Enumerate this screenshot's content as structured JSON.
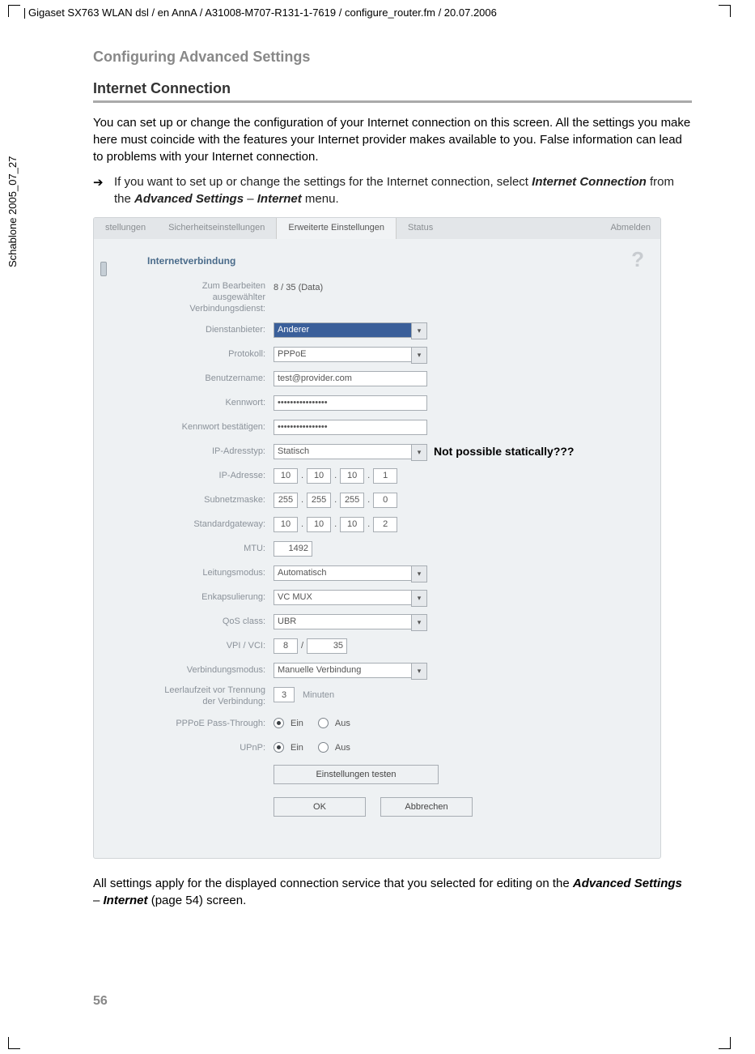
{
  "doc": {
    "header_path": "Gigaset SX763 WLAN dsl / en AnnA / A31008-M707-R131-1-7619 / configure_router.fm / 20.07.2006",
    "side_text": "Schablone 2005_07_27",
    "section_title": "Configuring Advanced Settings",
    "h2": "Internet Connection",
    "para1": "You can set up or change the configuration of your Internet connection on this screen. All the settings you make here must coincide with the features your Internet provider makes available to you. False information can lead to problems with your Internet connection.",
    "bullet_pre": "If you want to set up or change the settings for the Internet connection, select ",
    "bullet_bi1": "Internet Connection",
    "bullet_mid": " from the ",
    "bullet_bi2": "Advanced Settings",
    "bullet_sep": " – ",
    "bullet_bi3": "Internet",
    "bullet_post": " menu.",
    "foot_pre": "All settings apply for the displayed connection service that you selected for editing on the ",
    "foot_bi1": "Advanced Settings",
    "foot_sep": " – ",
    "foot_bi2": "Internet",
    "foot_post": " (page 54) screen.",
    "page_num": "56"
  },
  "ui": {
    "tabs": [
      "stellungen",
      "Sicherheitseinstellungen",
      "Erweiterte Einstellungen",
      "Status"
    ],
    "logout": "Abmelden",
    "panel_title": "Internetverbindung",
    "help": "?",
    "annotation": "Not possible statically???",
    "labels": {
      "service": "Zum Bearbeiten ausgewählter Verbindungsdienst:",
      "service_l1": "Zum Bearbeiten",
      "service_l2": "ausgewählter",
      "service_l3": "Verbindungsdienst:",
      "provider": "Dienstanbieter:",
      "protocol": "Protokoll:",
      "username": "Benutzername:",
      "password": "Kennwort:",
      "confirm": "Kennwort bestätigen:",
      "iptype": "IP-Adresstyp:",
      "ipaddr": "IP-Adresse:",
      "subnet": "Subnetzmaske:",
      "gateway": "Standardgateway:",
      "mtu": "MTU:",
      "linemode": "Leitungsmodus:",
      "encap": "Enkapsulierung:",
      "qos": "QoS class:",
      "vpivci": "VPI / VCI:",
      "connmode": "Verbindungsmodus:",
      "idle": "Leerlaufzeit vor Trennung der Verbindung:",
      "idle_l1": "Leerlaufzeit vor Trennung",
      "idle_l2": "der Verbindung:",
      "pppoe_pt": "PPPoE Pass-Through:",
      "upnp": "UPnP:"
    },
    "values": {
      "service_val": "8 / 35 (Data)",
      "provider_val": "Anderer",
      "protocol_val": "PPPoE",
      "username_val": "test@provider.com",
      "password_val": "••••••••••••••••",
      "confirm_val": "••••••••••••••••",
      "iptype_val": "Statisch",
      "ip": [
        "10",
        "10",
        "10",
        "1"
      ],
      "subnet": [
        "255",
        "255",
        "255",
        "0"
      ],
      "gateway": [
        "10",
        "10",
        "10",
        "2"
      ],
      "mtu_val": "1492",
      "linemode_val": "Automatisch",
      "encap_val": "VC MUX",
      "qos_val": "UBR",
      "vpi": "8",
      "vci": "35",
      "connmode_val": "Manuelle Verbindung",
      "idle_val": "3",
      "idle_unit": "Minuten",
      "on": "Ein",
      "off": "Aus"
    },
    "buttons": {
      "test": "Einstellungen testen",
      "ok": "OK",
      "cancel": "Abbrechen"
    }
  }
}
